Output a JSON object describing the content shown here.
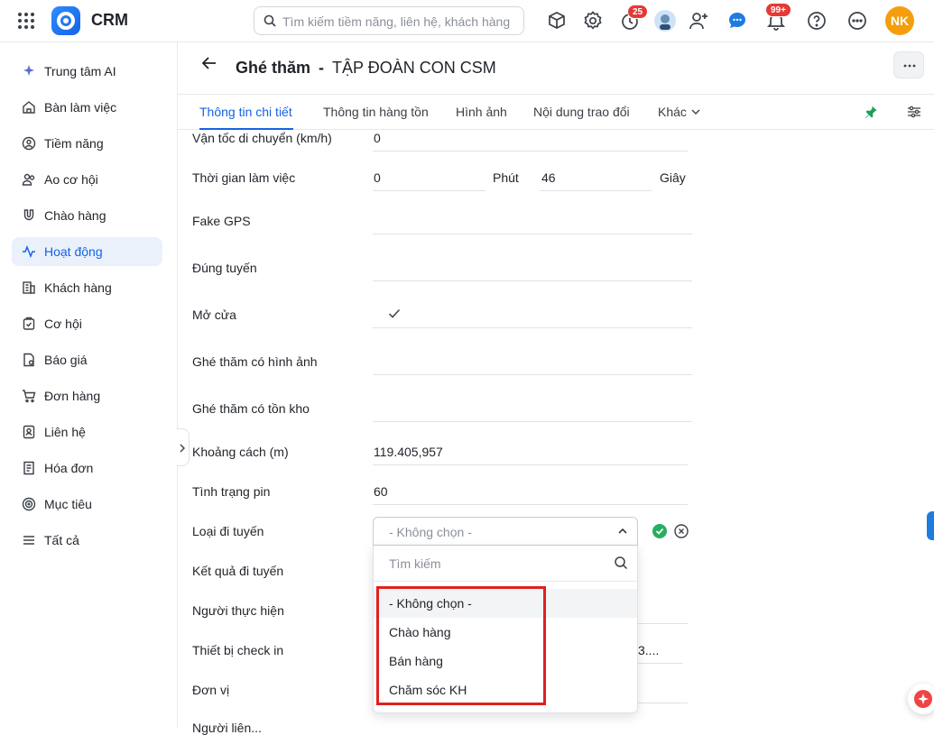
{
  "app": {
    "name": "CRM"
  },
  "search": {
    "placeholder": "Tìm kiếm tiềm năng, liên hệ, khách hàng"
  },
  "topbar": {
    "timer_badge": "25",
    "notif_badge": "99+",
    "avatar_initials": "NK"
  },
  "sidebar": {
    "items": [
      {
        "label": "Trung tâm AI",
        "icon": "sparkle-icon"
      },
      {
        "label": "Bàn làm việc",
        "icon": "home-icon"
      },
      {
        "label": "Tiềm năng",
        "icon": "prospect-icon"
      },
      {
        "label": "Ao cơ hội",
        "icon": "group-icon"
      },
      {
        "label": "Chào hàng",
        "icon": "magnet-icon"
      },
      {
        "label": "Hoạt động",
        "icon": "activity-icon",
        "active": true
      },
      {
        "label": "Khách hàng",
        "icon": "building-icon"
      },
      {
        "label": "Cơ hội",
        "icon": "opportunity-icon"
      },
      {
        "label": "Báo giá",
        "icon": "quote-icon"
      },
      {
        "label": "Đơn hàng",
        "icon": "cart-icon"
      },
      {
        "label": "Liên hệ",
        "icon": "contact-icon"
      },
      {
        "label": "Hóa đơn",
        "icon": "invoice-icon"
      },
      {
        "label": "Mục tiêu",
        "icon": "target-icon"
      },
      {
        "label": "Tất cả",
        "icon": "menu-icon"
      }
    ]
  },
  "page": {
    "title_prefix": "Ghé thăm",
    "title_sep": "-",
    "title_name": "TẬP ĐOÀN CON CSM"
  },
  "tabs": [
    "Thông tin chi tiết",
    "Thông tin hàng tồn",
    "Hình ảnh",
    "Nội dung trao đổi",
    "Khác"
  ],
  "fields": {
    "speed_label": "Vận tốc di chuyển (km/h)",
    "speed_value": "0",
    "worktime_label": "Thời gian làm việc",
    "worktime_minutes": "0",
    "minutes_unit": "Phút",
    "worktime_seconds": "46",
    "seconds_unit": "Giây",
    "fakegps_label": "Fake GPS",
    "ontrack_label": "Đúng tuyến",
    "open_label": "Mở cửa",
    "visit_image_label": "Ghé thăm có hình ảnh",
    "visit_stock_label": "Ghé thăm có tồn kho",
    "distance_label": "Khoảng cách (m)",
    "distance_value": "119.405,957",
    "battery_label": "Tình trạng pin",
    "battery_value": "60",
    "route_type_label": "Loại đi tuyến",
    "route_type_value": "- Không chọn -",
    "route_result_label": "Kết quả đi tuyến",
    "performer_label": "Người thực hiện",
    "device_label": "Thiết bị check in",
    "device_value_partial": "3....",
    "unit_label": "Đơn vị",
    "partial_label": "Người liên..."
  },
  "dropdown": {
    "search_placeholder": "Tìm kiếm",
    "options": [
      "- Không chọn -",
      "Chào hàng",
      "Bán hàng",
      "Chăm sóc KH"
    ]
  },
  "colors": {
    "accent": "#1463e6",
    "highlight_frame": "#e02020",
    "badge": "#e53935",
    "avatar": "#f59e0b"
  }
}
